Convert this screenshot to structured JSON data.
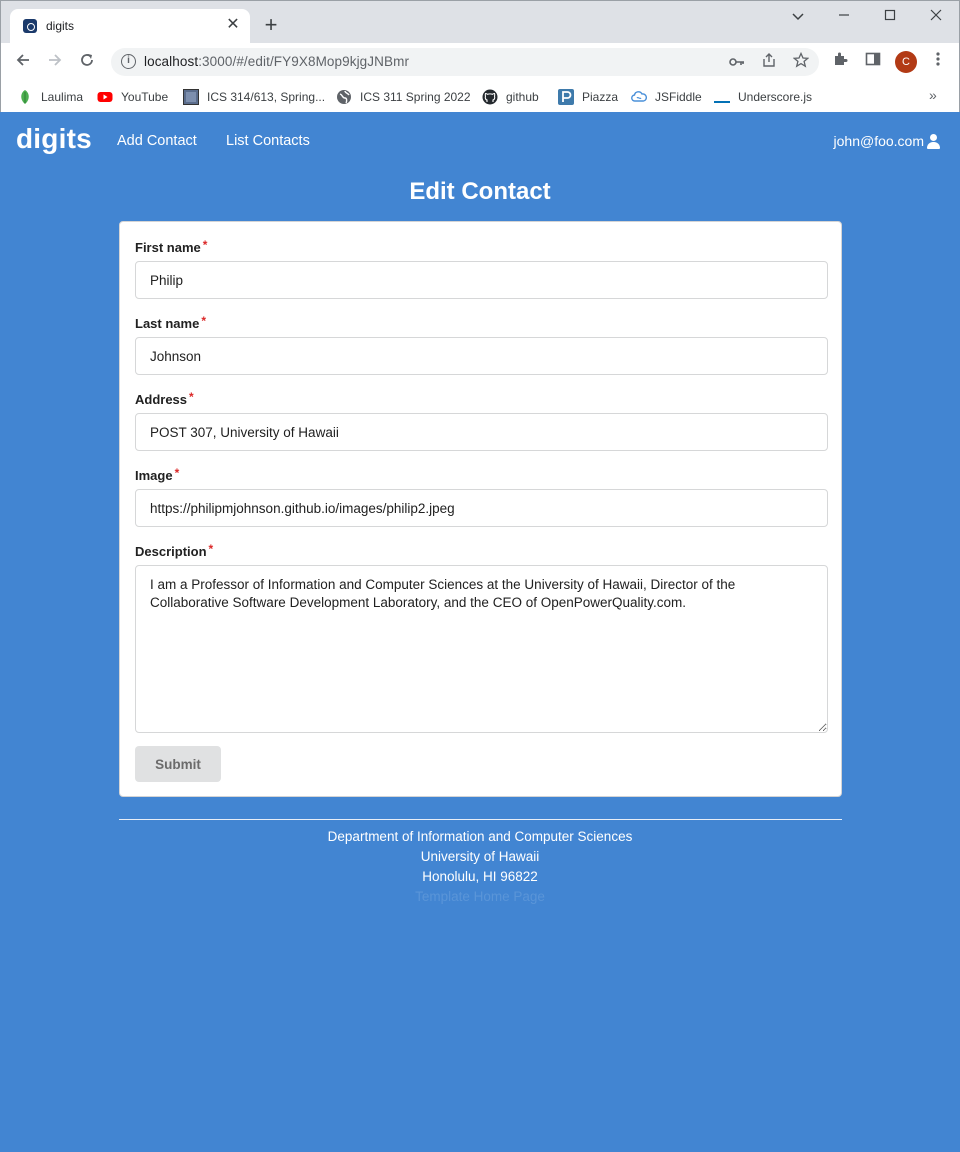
{
  "browser": {
    "tab_title": "digits",
    "new_tab_symbol": "+",
    "close_symbol": "✕",
    "url_host": "localhost",
    "url_path": ":3000/#/edit/FY9X8Mop9kjgJNBmr",
    "profile_initial": "C",
    "bookmarks": [
      {
        "label": "Laulima",
        "icon": "laulima-leaf-icon",
        "color": "#4caf50"
      },
      {
        "label": "YouTube",
        "icon": "youtube-icon",
        "color": "#ff0000"
      },
      {
        "label": "ICS 314/613, Spring...",
        "icon": "ics314-icon",
        "color": "#5b6d8c"
      },
      {
        "label": "ICS 311 Spring 2022",
        "icon": "globe-icon",
        "color": "#5f6368"
      },
      {
        "label": "github",
        "icon": "github-icon",
        "color": "#24292e"
      },
      {
        "label": "Piazza",
        "icon": "piazza-icon",
        "color": "#3e7aab"
      },
      {
        "label": "JSFiddle",
        "icon": "jsfiddle-cloud-icon",
        "color": "#4a90d9"
      },
      {
        "label": "Underscore.js",
        "icon": "underscore-icon",
        "color": "#0371b5"
      }
    ]
  },
  "navbar": {
    "brand": "digits",
    "links": [
      "Add Contact",
      "List Contacts"
    ],
    "user": "john@foo.com"
  },
  "page_title": "Edit Contact",
  "form": {
    "first_name": {
      "label": "First name",
      "value": "Philip"
    },
    "last_name": {
      "label": "Last name",
      "value": "Johnson"
    },
    "address": {
      "label": "Address",
      "value": "POST 307, University of Hawaii"
    },
    "image": {
      "label": "Image",
      "value": "https://philipmjohnson.github.io/images/philip2.jpeg"
    },
    "description": {
      "label": "Description",
      "value": "I am a Professor of Information and Computer Sciences at the University of Hawaii, Director of the Collaborative Software Development Laboratory, and the CEO of OpenPowerQuality.com."
    },
    "required_mark": "*",
    "submit_label": "Submit"
  },
  "footer": {
    "line1": "Department of Information and Computer Sciences",
    "line2": "University of Hawaii",
    "line3": "Honolulu, HI 96822",
    "line4": "Template Home Page"
  },
  "colors": {
    "page_background": "#4285d2",
    "required": "#db2828",
    "submit_background": "#e0e1e2"
  }
}
